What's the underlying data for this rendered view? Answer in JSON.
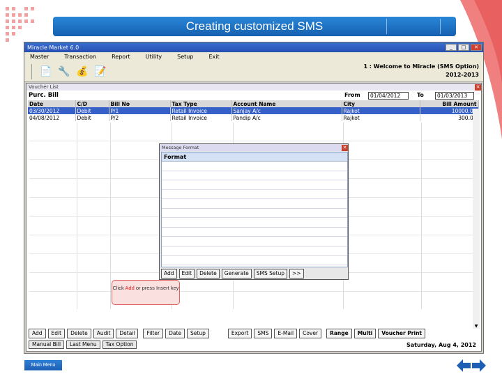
{
  "slide": {
    "title": "Creating customized SMS",
    "main_menu_label": "Main Menu",
    "callout_prefix": "Click ",
    "callout_highlight": "Add",
    "callout_suffix": " or press Insert key"
  },
  "app": {
    "window_title": "Miracle Market 6.0",
    "menu": [
      "Master",
      "Transaction",
      "Report",
      "Utility",
      "Setup",
      "Exit"
    ],
    "company_line1": "1 : Welcome to Miracle (SMS Option)",
    "company_line2": "2012-2013",
    "voucher_list": {
      "title": "Voucher List",
      "heading": "Purc. Bill",
      "from_label": "From",
      "from_value": "01/04/2012",
      "to_label": "To",
      "to_value": "01/03/2013",
      "columns": [
        "Date",
        "C/D",
        "Bill No",
        "Tax Type",
        "Account Name",
        "City",
        "Bill Amount"
      ],
      "rows": [
        [
          "03/30/2012",
          "Debit",
          "P/1",
          "Retail Invoice",
          "Sanjay A/c",
          "Rajkot",
          "10000.00"
        ],
        [
          "04/08/2012",
          "Debit",
          "P/2",
          "Retail Invoice",
          "Pandip A/c",
          "Rajkot",
          "300.00"
        ]
      ],
      "buttons": [
        "Add",
        "Edit",
        "Delete",
        "Audit",
        "Detail",
        "Filter",
        "Date",
        "Setup",
        "Export",
        "SMS",
        "E-Mail",
        "Cover",
        "Range",
        "Multi",
        "Voucher Print"
      ],
      "tasks": [
        "Manual Bill",
        "Last Menu",
        "Tax Option"
      ],
      "status_date": "Saturday, Aug 4, 2012"
    },
    "message_format": {
      "title": "Message Format",
      "column": "Format",
      "buttons": [
        "Add",
        "Edit",
        "Delete",
        "Generate",
        "SMS Setup",
        ">>"
      ]
    }
  }
}
